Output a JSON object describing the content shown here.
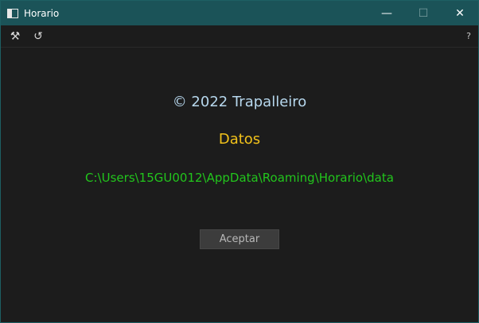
{
  "window": {
    "title": "Horario",
    "minimize_glyph": "—",
    "maximize_glyph": "☐",
    "close_glyph": "✕"
  },
  "toolbar": {
    "tools_glyph": "⚒",
    "refresh_glyph": "↺",
    "help_label": "?"
  },
  "about": {
    "copyright": "© 2022 Trapalleiro",
    "data_heading": "Datos",
    "data_path": "C:\\Users\\15GU0012\\AppData\\Roaming\\Horario\\data",
    "accept_label": "Aceptar"
  },
  "colors": {
    "titlebar": "#1b5358",
    "background": "#1c1c1c",
    "copyright": "#b7d8ee",
    "heading": "#f2c21a",
    "path": "#22c51c"
  }
}
